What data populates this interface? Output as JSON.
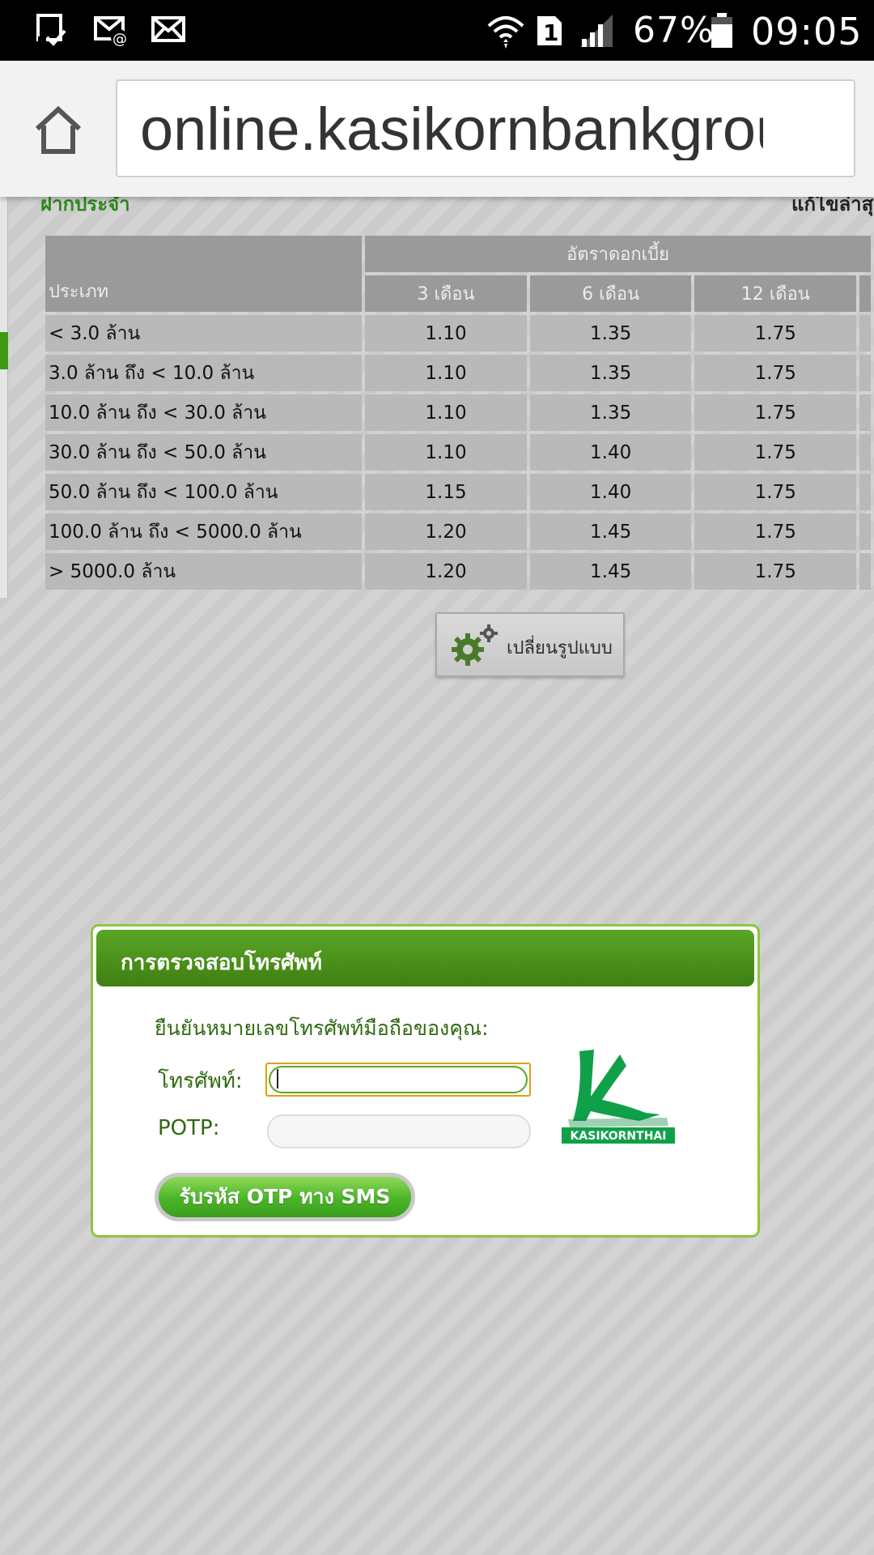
{
  "status_bar": {
    "battery_percent": "67%",
    "time": "09:05",
    "sim_slot": "1",
    "icons": [
      "screenshot-notification-icon",
      "email-icon",
      "mail-icon",
      "wifi-icon",
      "sim-icon",
      "signal-icon",
      "battery-icon"
    ]
  },
  "browser": {
    "url": "online.kasikornbankgroup.com"
  },
  "page": {
    "crumb_left": "ฝากประจำ",
    "crumb_right": "แก้ไขล่าสุด",
    "table": {
      "type_header": "ประเภท",
      "rate_header": "อัตราดอกเบี้ย",
      "terms": [
        "3 เดือน",
        "6 เดือน",
        "12 เดือน"
      ],
      "rows": [
        {
          "type": "< 3.0 ล้าน",
          "r3": "1.10",
          "r6": "1.35",
          "r12": "1.75"
        },
        {
          "type": "3.0 ล้าน ถึง < 10.0 ล้าน",
          "r3": "1.10",
          "r6": "1.35",
          "r12": "1.75"
        },
        {
          "type": "10.0 ล้าน ถึง < 30.0 ล้าน",
          "r3": "1.10",
          "r6": "1.35",
          "r12": "1.75"
        },
        {
          "type": "30.0 ล้าน ถึง < 50.0 ล้าน",
          "r3": "1.10",
          "r6": "1.40",
          "r12": "1.75"
        },
        {
          "type": "50.0 ล้าน ถึง < 100.0 ล้าน",
          "r3": "1.15",
          "r6": "1.40",
          "r12": "1.75"
        },
        {
          "type": "100.0 ล้าน ถึง < 5000.0 ล้าน",
          "r3": "1.20",
          "r6": "1.45",
          "r12": "1.75"
        },
        {
          "type": "> 5000.0 ล้าน",
          "r3": "1.20",
          "r6": "1.45",
          "r12": "1.75"
        }
      ]
    },
    "change_format_label": "เปลี่ยนรูปแบบ"
  },
  "dialog": {
    "title": "การตรวจสอบโทรศัพท์",
    "prompt": "ยืนยันหมายเลขโทรศัพท์มือถือของคุณ:",
    "phone_label": "โทรศัพท์:",
    "phone_value": "",
    "potp_label": "POTP:",
    "potp_value": "",
    "otp_button_label": "รับรหัส OTP ทาง SMS",
    "logo_text": "KASIKORNTHAI"
  },
  "colors": {
    "brand_green": "#3f7f12",
    "button_green": "#4ab427",
    "dialog_border": "#8cc63f"
  }
}
